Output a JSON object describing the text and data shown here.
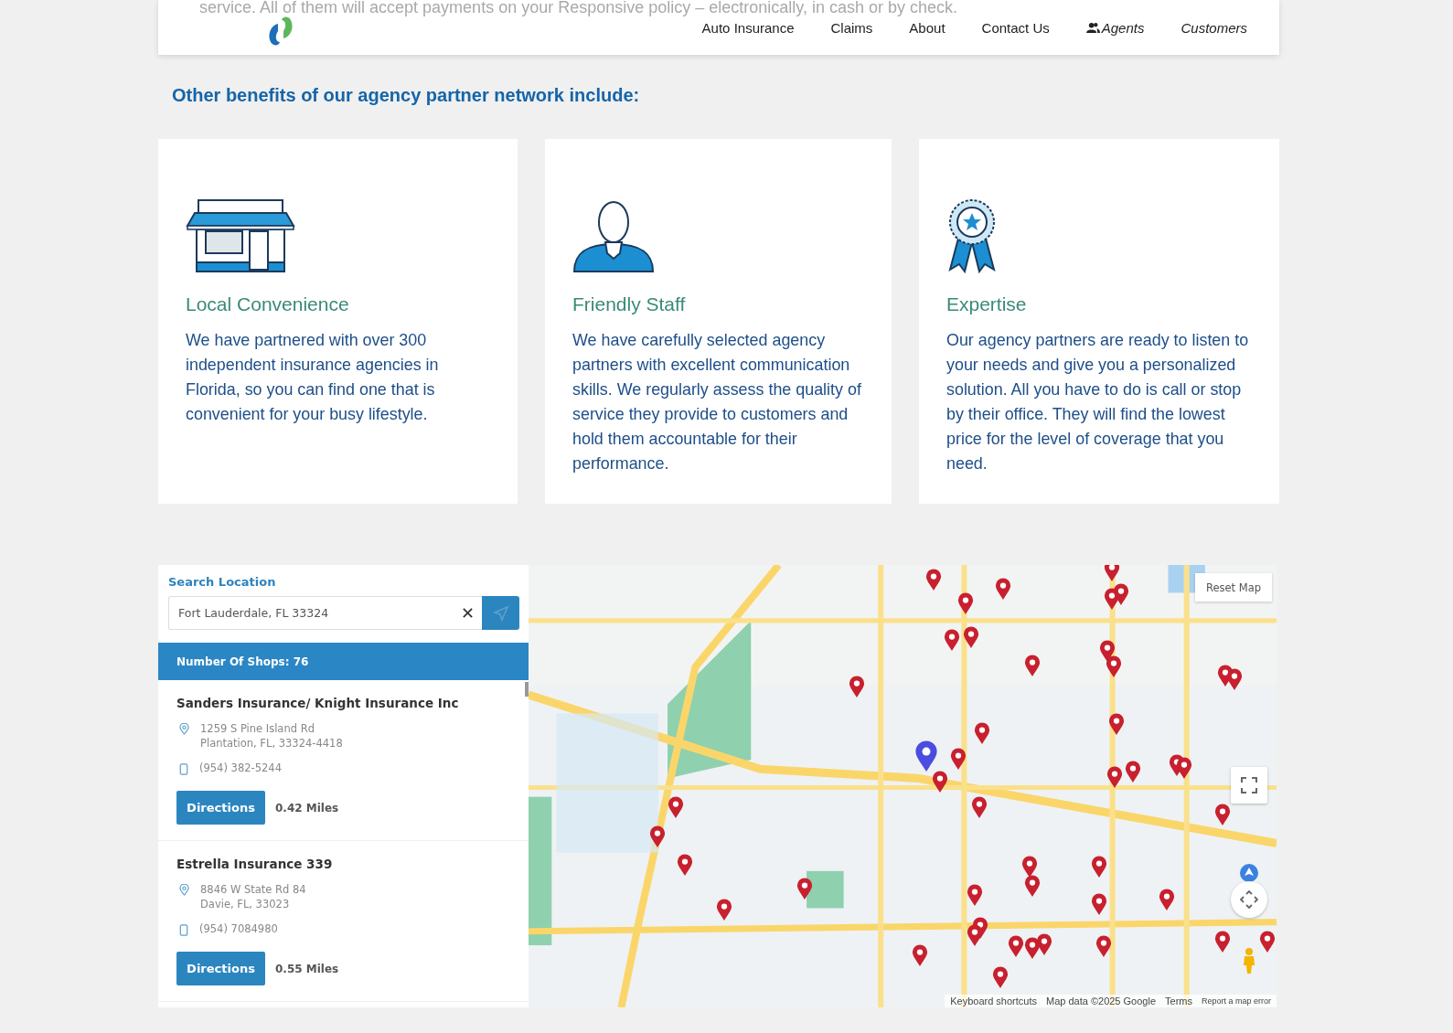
{
  "background_text": "service. All of them will accept payments on your Responsive policy – electronically, in cash or by check.",
  "nav": {
    "items": [
      {
        "label": "Auto Insurance",
        "kind": "link"
      },
      {
        "label": "Claims",
        "kind": "link"
      },
      {
        "label": "About",
        "kind": "link"
      },
      {
        "label": "Contact Us",
        "kind": "link"
      },
      {
        "label": "Agents",
        "kind": "portal-icon"
      },
      {
        "label": "Customers",
        "kind": "portal"
      }
    ]
  },
  "section_title": "Other benefits of our agency partner network include:",
  "benefits": [
    {
      "kind": "storefront",
      "title": "Local Convenience",
      "text": "We have partnered with over 300 independent insurance agencies in Florida, so you can find one that is convenient for your busy lifestyle."
    },
    {
      "kind": "staff",
      "title": "Friendly Staff",
      "text": "We have carefully selected agency partners with excellent communication skills. We regularly assess the quality of service they provide to customers and hold them accountable for their performance."
    },
    {
      "kind": "ribbon",
      "title": "Expertise",
      "text": "Our agency partners are ready to listen to your needs and give you a personalized solution. All you have to do is call or stop by their office. They will find the lowest price for the level of coverage that you need."
    }
  ],
  "locator": {
    "label": "Search Location",
    "search": {
      "value": "Fort Lauderdale, FL 33324"
    },
    "count_label": "Number Of Shops: 76",
    "shops": [
      {
        "name": "Sanders Insurance/ Knight Insurance Inc",
        "address_line1": "1259 S Pine Island Rd",
        "address_line2": "Plantation, FL, 33324-4418",
        "phone": "(954) 382-5244",
        "button": "Directions",
        "distance": "0.42 Miles"
      },
      {
        "name": "Estrella Insurance 339",
        "address_line1": "8846 W State Rd 84",
        "address_line2": "Davie, FL, 33023",
        "phone": "(954) 7084980",
        "button": "Directions",
        "distance": "0.55 Miles"
      }
    ]
  },
  "map": {
    "reset_button": "Reset Map",
    "attribution": [
      "Keyboard shortcuts",
      "Map data ©2025 Google",
      "Terms",
      "Report a map error"
    ]
  }
}
